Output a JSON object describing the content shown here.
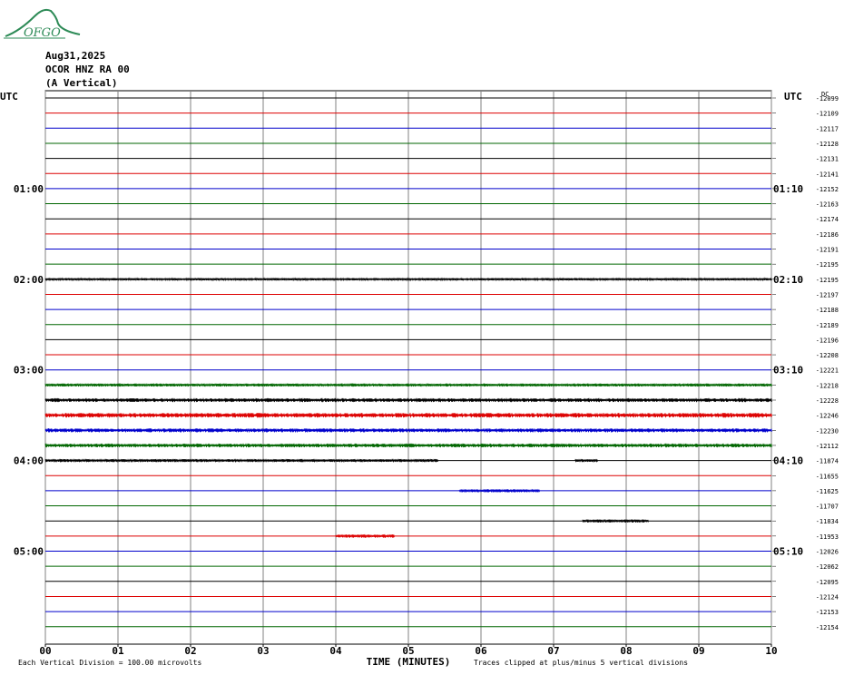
{
  "header": {
    "logo_text": "OFGO",
    "date": "Aug31,2025",
    "station": "OCOR HNZ RA 00",
    "component": "(A Vertical)"
  },
  "colors": {
    "black": "#000000",
    "red": "#dd0000",
    "blue": "#0000cc",
    "green": "#006600",
    "grid": "#808080",
    "logo": "#2e8b57"
  },
  "chart_data": {
    "type": "line",
    "title": "",
    "xlabel": "TIME (MINUTES)",
    "x_ticks": [
      "00",
      "01",
      "02",
      "03",
      "04",
      "05",
      "06",
      "07",
      "08",
      "09",
      "10"
    ],
    "xlim": [
      0,
      10
    ],
    "left_axis_label": "UTC",
    "right_axis_label": "UTC",
    "right_col_header": "DC",
    "left_hour_labels": [
      {
        "row": 6,
        "label": "01:00"
      },
      {
        "row": 12,
        "label": "02:00"
      },
      {
        "row": 18,
        "label": "03:00"
      },
      {
        "row": 24,
        "label": "04:00"
      },
      {
        "row": 30,
        "label": "05:00"
      }
    ],
    "right_hour_labels": [
      {
        "row": 6,
        "label": "01:10"
      },
      {
        "row": 12,
        "label": "02:10"
      },
      {
        "row": 18,
        "label": "03:10"
      },
      {
        "row": 24,
        "label": "04:10"
      },
      {
        "row": 30,
        "label": "05:10"
      }
    ],
    "trace_colors_cycle": [
      "black",
      "red",
      "blue",
      "green"
    ],
    "dc_offsets": [
      -12099,
      -12109,
      -12117,
      -12128,
      -12131,
      -12141,
      -12152,
      -12163,
      -12174,
      -12186,
      -12191,
      -12195,
      -12195,
      -12197,
      -12188,
      -12189,
      -12196,
      -12208,
      -12221,
      -12218,
      -12228,
      -12246,
      -12230,
      -12112,
      -11874,
      -11655,
      -11625,
      -11707,
      -11834,
      -11953,
      -12026,
      -12062,
      -12095,
      -12124,
      -12153,
      -12154
    ],
    "active_traces": [
      {
        "row": 12,
        "x_start": 0,
        "x_end": 10,
        "intensity": 0.6
      },
      {
        "row": 19,
        "x_start": 0,
        "x_end": 10,
        "intensity": 0.8
      },
      {
        "row": 20,
        "x_start": 0,
        "x_end": 10,
        "intensity": 1.0
      },
      {
        "row": 21,
        "x_start": 0,
        "x_end": 10,
        "intensity": 1.2
      },
      {
        "row": 22,
        "x_start": 0,
        "x_end": 10,
        "intensity": 1.0
      },
      {
        "row": 23,
        "x_start": 0,
        "x_end": 10,
        "intensity": 1.0
      },
      {
        "row": 24,
        "x_start": 0,
        "x_end": 5.4,
        "intensity": 0.8
      },
      {
        "row": 24,
        "x_start": 7.3,
        "x_end": 7.6,
        "intensity": 0.8
      },
      {
        "row": 26,
        "x_start": 5.7,
        "x_end": 6.8,
        "intensity": 0.8
      },
      {
        "row": 28,
        "x_start": 7.4,
        "x_end": 8.3,
        "intensity": 0.8
      },
      {
        "row": 29,
        "x_start": 4.0,
        "x_end": 4.8,
        "intensity": 0.9
      }
    ],
    "footer_left": "Each Vertical Division =  100.00 microvolts",
    "footer_right": "Traces clipped at plus/minus 5 vertical divisions"
  }
}
